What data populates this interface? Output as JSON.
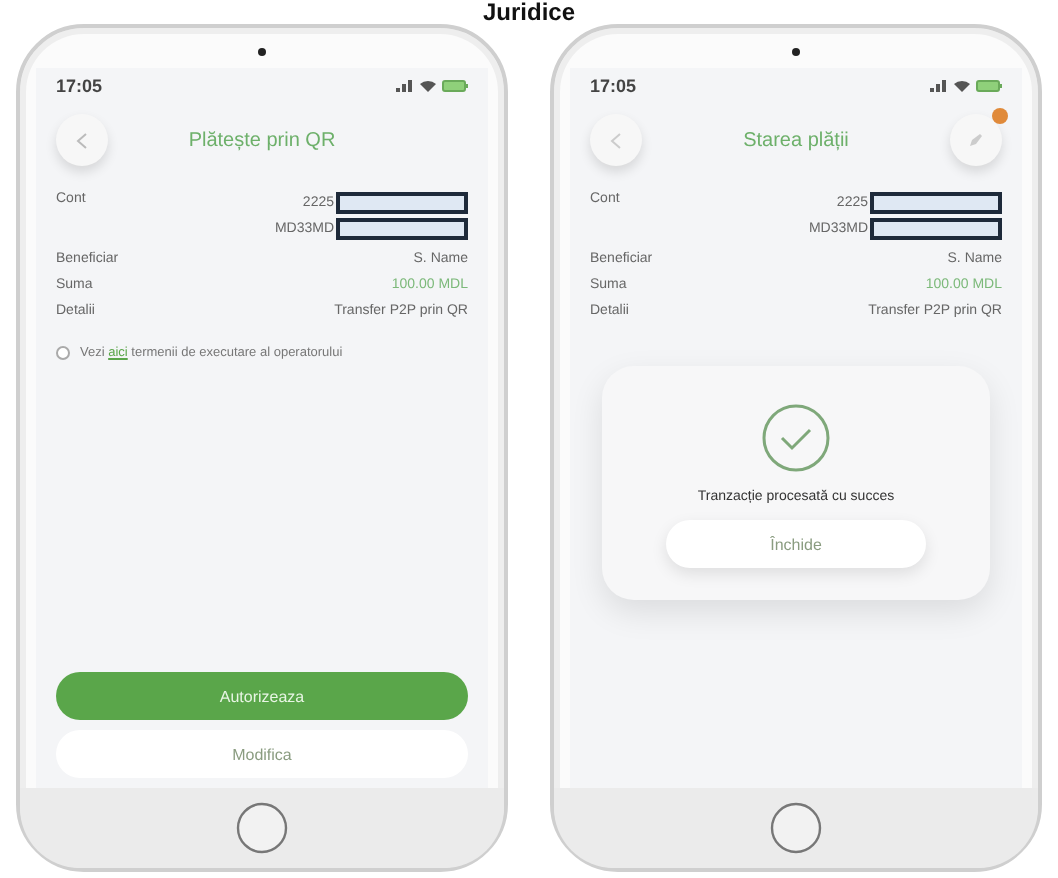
{
  "page_title": "Juridice",
  "phones": [
    {
      "kind": "form",
      "time": "17:05",
      "title": "Plătește prin QR",
      "details": [
        {
          "label": "Cont",
          "values": [
            "2225",
            "MD33MD"
          ],
          "redacted": true,
          "highlight": false
        },
        {
          "label": "Beneficiar",
          "values": [
            "S. Name"
          ],
          "redacted": false,
          "highlight": false
        },
        {
          "label": "Suma",
          "values": [
            "100.00 MDL"
          ],
          "redacted": false,
          "highlight": true
        },
        {
          "label": "Detalii",
          "values": [
            "Transfer P2P prin QR"
          ],
          "redacted": false,
          "highlight": false
        }
      ],
      "terms": {
        "before": "Vezi ",
        "link": "aici",
        "after": " termenii de executare al operatorului",
        "checked": false
      },
      "buttons": [
        {
          "label": "Autorizeaza",
          "primary": true
        },
        {
          "label": "Modifica",
          "primary": false
        }
      ]
    },
    {
      "kind": "status",
      "time": "17:05",
      "title": "Starea plății",
      "badge": true,
      "details": [
        {
          "label": "Cont",
          "values": [
            "2225",
            "MD33MD"
          ],
          "redacted": true,
          "highlight": false
        },
        {
          "label": "Beneficiar",
          "values": [
            "S. Name"
          ],
          "redacted": false,
          "highlight": false
        },
        {
          "label": "Suma",
          "values": [
            "100.00 MDL"
          ],
          "redacted": false,
          "highlight": true
        },
        {
          "label": "Detalii",
          "values": [
            "Transfer P2P prin QR"
          ],
          "redacted": false,
          "highlight": false
        }
      ],
      "message": "Tranzacție procesată cu succes",
      "buttons": [
        {
          "label": "Închide",
          "primary": false
        }
      ]
    }
  ]
}
